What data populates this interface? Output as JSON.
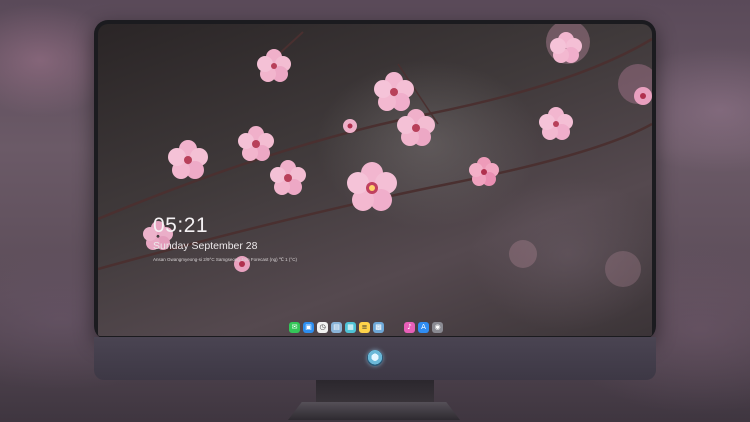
{
  "lock_screen": {
    "time": "05:21",
    "date": "Sunday September  28",
    "weather_line": "Ansan Gwangmyeong-si 2/9°C  Samgseong  Jam Forecast (ng) ℃ 1 (°C)"
  },
  "dock": {
    "apps": [
      {
        "name": "messages-app-icon",
        "glyph": "✉",
        "color": "#34c759"
      },
      {
        "name": "finder-app-icon",
        "glyph": "▣",
        "color": "#2c8ef0"
      },
      {
        "name": "clock-app-icon",
        "glyph": "◷",
        "color": "#f2f2f2"
      },
      {
        "name": "preview-app-icon",
        "glyph": "▤",
        "color": "#8ab4d8"
      },
      {
        "name": "finalcut-app-icon",
        "glyph": "▦",
        "color": "#4fc3d6"
      },
      {
        "name": "notes-app-icon",
        "glyph": "≡",
        "color": "#ffd34a"
      },
      {
        "name": "photos-app-icon",
        "glyph": "▩",
        "color": "#6ea8d8"
      },
      {
        "name": "itunes-app-icon",
        "glyph": "♪",
        "color": "#e85fb8"
      },
      {
        "name": "appstore-app-icon",
        "glyph": "A",
        "color": "#2f8cf2"
      },
      {
        "name": "camera-app-icon",
        "glyph": "◉",
        "color": "#8a8a92"
      }
    ]
  }
}
